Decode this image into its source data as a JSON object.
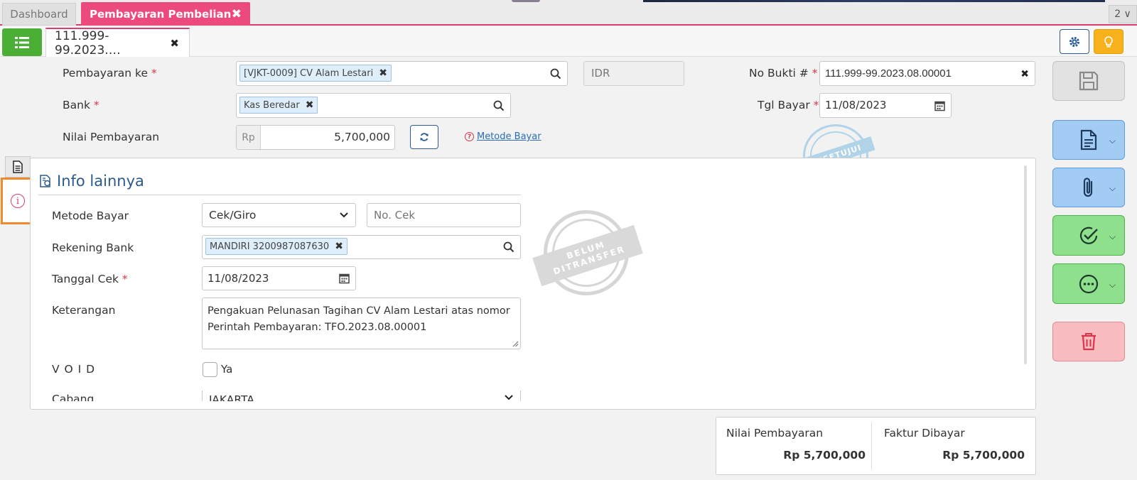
{
  "top_tabs": {
    "dashboard": "Dashboard",
    "active": "Pembayaran Pembelian",
    "counter": "2 ∨"
  },
  "doc_tab": {
    "label": "111.999-99.2023.…"
  },
  "form": {
    "pembayaran_ke": {
      "label": "Pembayaran ke",
      "required": "*",
      "chip": "[VJKT-0009] CV Alam Lestari"
    },
    "currency": "IDR",
    "no_bukti": {
      "label": "No Bukti #",
      "required": "*",
      "value": "111.999-99.2023.08.00001"
    },
    "bank": {
      "label": "Bank",
      "required": "*",
      "chip": "Kas Beredar"
    },
    "tgl_bayar": {
      "label": "Tgl Bayar",
      "required": "*",
      "value": "11/08/2023"
    },
    "nilai_pembayaran": {
      "label": "Nilai Pembayaran",
      "prefix": "Rp",
      "value": "5,700,000"
    },
    "metode_bayar_link": "Metode Bayar"
  },
  "stamps": {
    "approved": "DISETUJUI",
    "not_transferred_1": "BELUM",
    "not_transferred_2": "DITRANSFER"
  },
  "info": {
    "title": "Info lainnya",
    "metode_bayar": {
      "label": "Metode Bayar",
      "value": "Cek/Giro",
      "no_cek_placeholder": "No. Cek"
    },
    "rekening_bank": {
      "label": "Rekening Bank",
      "chip": "MANDIRI 3200987087630"
    },
    "tanggal_cek": {
      "label": "Tanggal Cek",
      "required": "*",
      "value": "11/08/2023"
    },
    "keterangan": {
      "label": "Keterangan",
      "value": "Pengakuan Pelunasan Tagihan CV Alam Lestari atas nomor Perintah Pembayaran: TFO.2023.08.00001"
    },
    "void": {
      "label": "V O I D",
      "option": "Ya"
    },
    "cabang": {
      "label": "Cabang",
      "value": "JAKARTA"
    }
  },
  "summary": {
    "nilai_pembayaran": {
      "label": "Nilai Pembayaran",
      "value": "Rp 5,700,000"
    },
    "faktur_dibayar": {
      "label": "Faktur Dibayar",
      "value": "Rp 5,700,000"
    }
  },
  "colors": {
    "accent_pink": "#ec4a7d",
    "list_green": "#4caf35",
    "highlight_orange": "#f08a2c",
    "bulb_yellow": "#f6b11b"
  }
}
